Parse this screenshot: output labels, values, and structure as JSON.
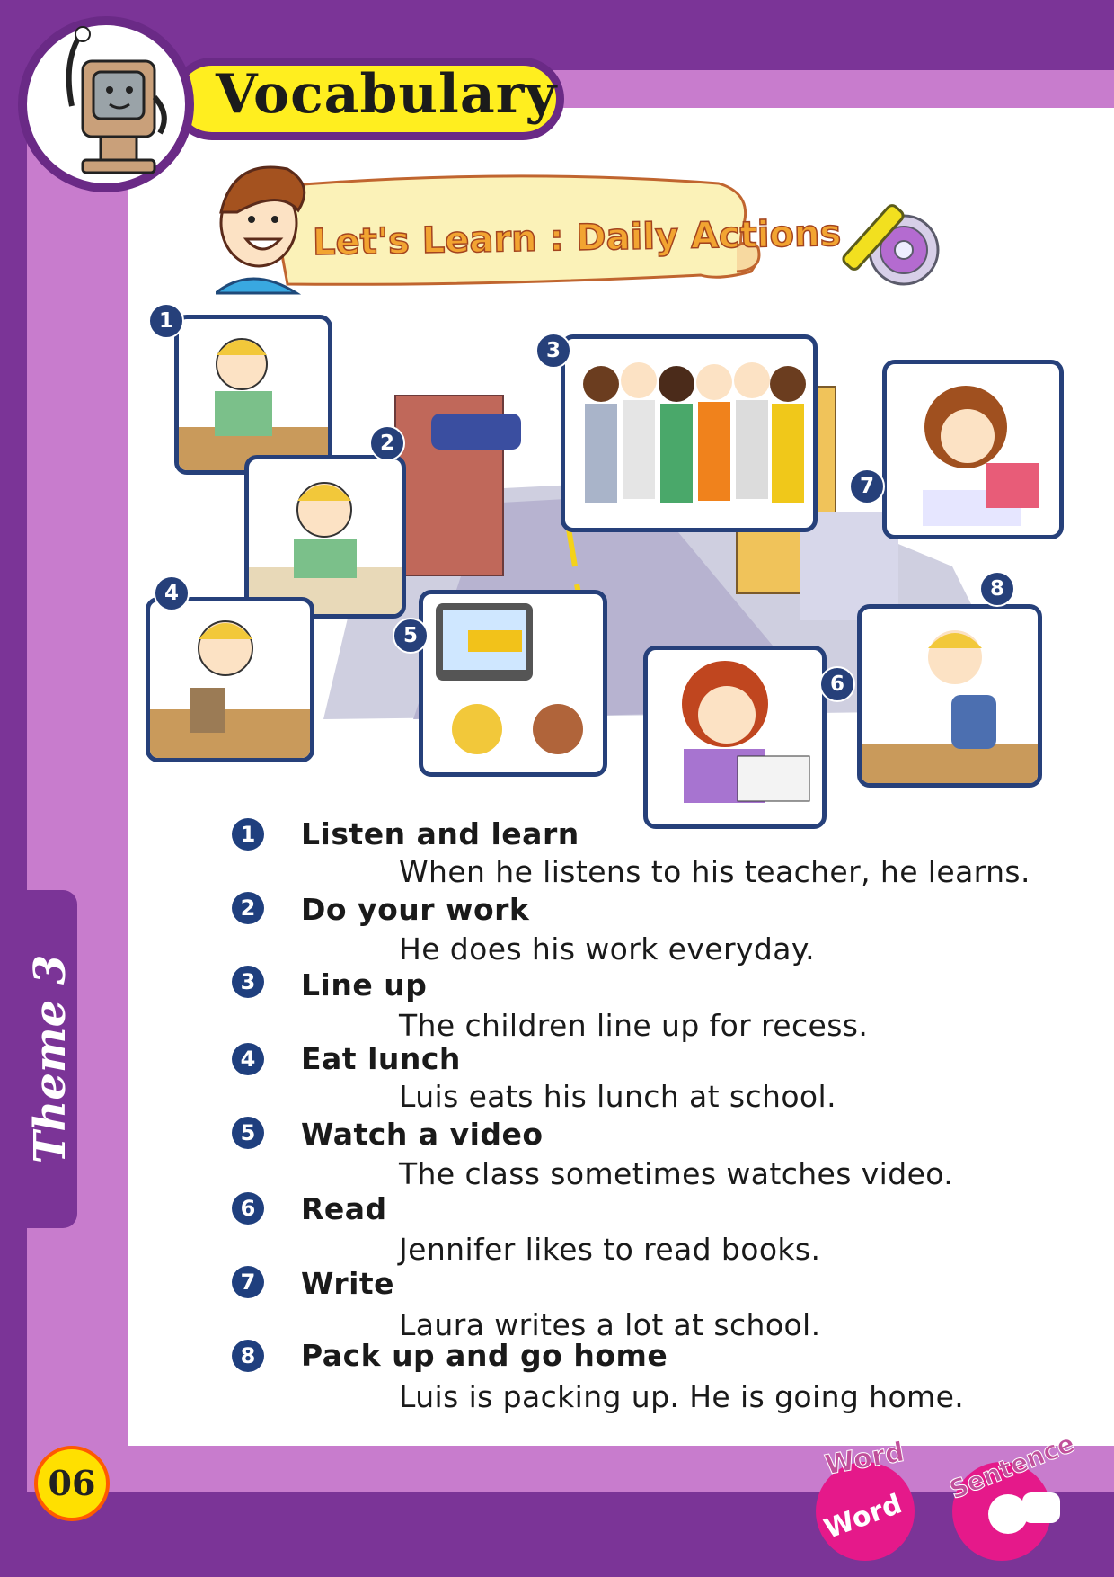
{
  "header": {
    "title": "Vocabulary",
    "banner": "Let's Learn : Daily Actions"
  },
  "side_tab": {
    "label": "Theme 3"
  },
  "page_number": "06",
  "picture_numbers": [
    "1",
    "2",
    "3",
    "4",
    "5",
    "6",
    "7",
    "8"
  ],
  "vocabulary": [
    {
      "num": "1",
      "term": "Listen and learn",
      "sentence": "When he listens to his teacher, he learns."
    },
    {
      "num": "2",
      "term": "Do your work",
      "sentence": "He does his work everyday."
    },
    {
      "num": "3",
      "term": "Line up",
      "sentence": "The children line up for recess."
    },
    {
      "num": "4",
      "term": "Eat lunch",
      "sentence": "Luis eats his lunch at school."
    },
    {
      "num": "5",
      "term": "Watch a video",
      "sentence": "The class sometimes watches video."
    },
    {
      "num": "6",
      "term": "Read",
      "sentence": "Jennifer likes to read books."
    },
    {
      "num": "7",
      "term": "Write",
      "sentence": "Laura writes a lot at school."
    },
    {
      "num": "8",
      "term": "Pack up and go home",
      "sentence": "Luis is packing up. He is going home."
    }
  ],
  "logos": {
    "word": "Word",
    "sentence": "Sentence"
  },
  "colors": {
    "frame_dark": "#7b3497",
    "frame_light": "#c87ccd",
    "title_yellow": "#ffee1f",
    "number_blue": "#1f3f7e"
  }
}
